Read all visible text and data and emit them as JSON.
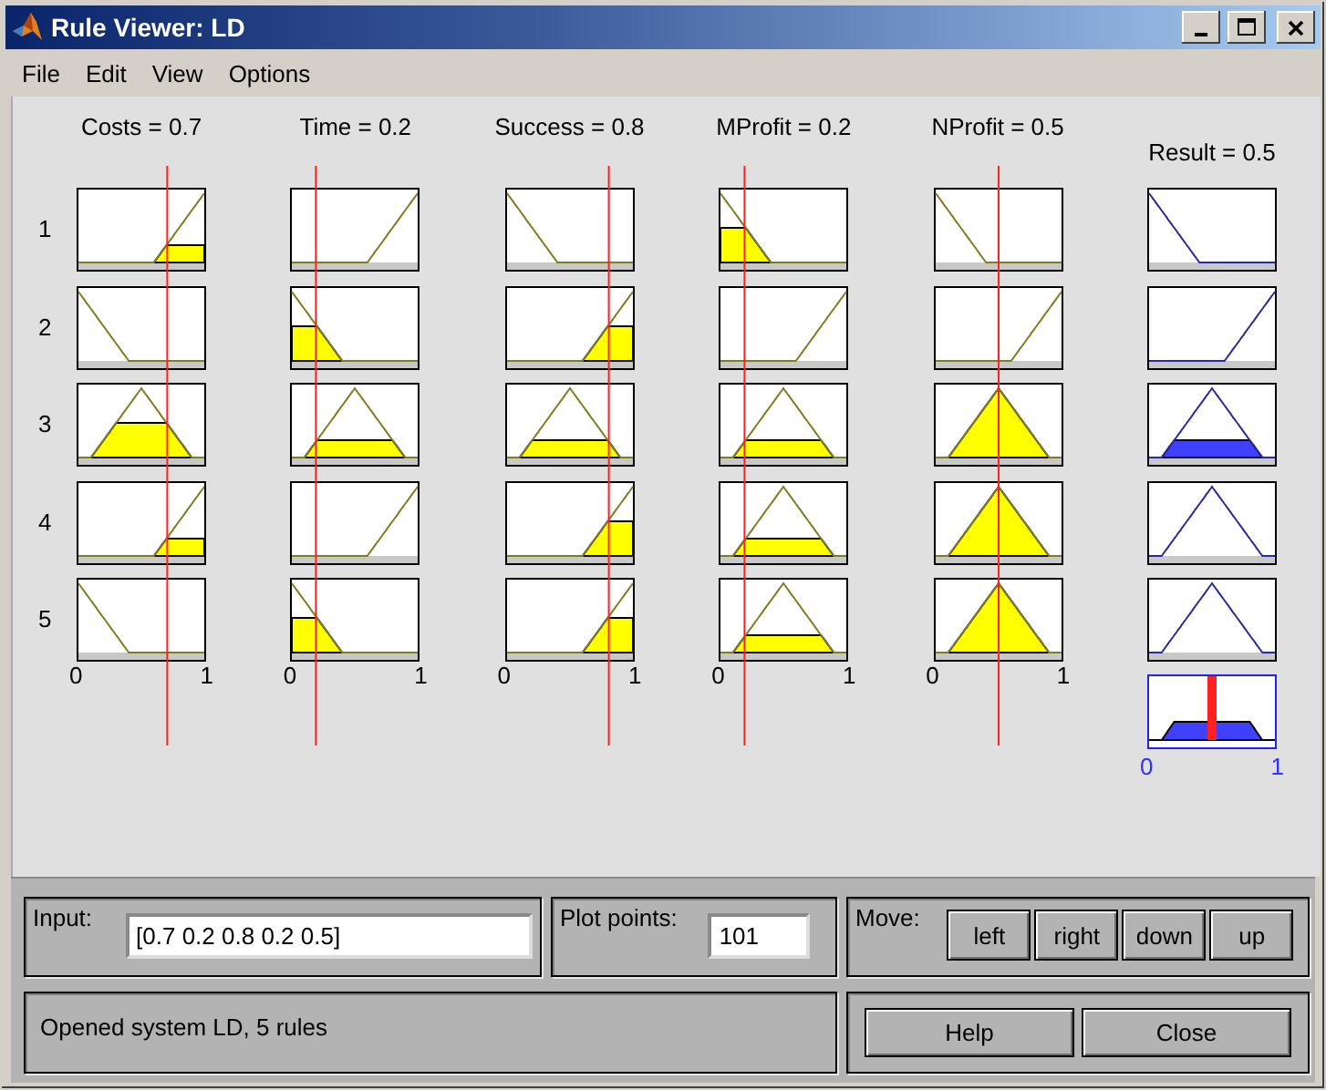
{
  "window": {
    "title": "Rule Viewer: LD"
  },
  "menu": [
    {
      "label": "File"
    },
    {
      "label": "Edit"
    },
    {
      "label": "View"
    },
    {
      "label": "Options"
    }
  ],
  "rule_numbers": [
    "1",
    "2",
    "3",
    "4",
    "5"
  ],
  "variables": [
    {
      "kind": "input",
      "label": "Costs = 0.7",
      "level": 0.7,
      "cells": [
        {
          "kind": "rising"
        },
        {
          "kind": "falling"
        },
        {
          "kind": "triangle"
        },
        {
          "kind": "rising"
        },
        {
          "kind": "falling"
        }
      ],
      "axis": [
        "0",
        "1"
      ]
    },
    {
      "kind": "input",
      "label": "Time = 0.2",
      "level": 0.2,
      "cells": [
        {
          "kind": "rising"
        },
        {
          "kind": "falling"
        },
        {
          "kind": "triangle"
        },
        {
          "kind": "rising"
        },
        {
          "kind": "falling"
        }
      ],
      "axis": [
        "0",
        "1"
      ]
    },
    {
      "kind": "input",
      "label": "Success = 0.8",
      "level": 0.8,
      "cells": [
        {
          "kind": "falling"
        },
        {
          "kind": "rising"
        },
        {
          "kind": "triangle"
        },
        {
          "kind": "rising"
        },
        {
          "kind": "rising"
        }
      ],
      "axis": [
        "0",
        "1"
      ]
    },
    {
      "kind": "input",
      "label": "MProfit = 0.2",
      "level": 0.2,
      "cells": [
        {
          "kind": "falling"
        },
        {
          "kind": "rising"
        },
        {
          "kind": "triangle"
        },
        {
          "kind": "triangle"
        },
        {
          "kind": "triangle"
        }
      ],
      "axis": [
        "0",
        "1"
      ]
    },
    {
      "kind": "input",
      "label": "NProfit = 0.5",
      "level": 0.5,
      "cells": [
        {
          "kind": "falling"
        },
        {
          "kind": "rising"
        },
        {
          "kind": "triangle"
        },
        {
          "kind": "triangle"
        },
        {
          "kind": "triangle"
        }
      ],
      "axis": [
        "0",
        "1"
      ]
    },
    {
      "kind": "output",
      "label": "Result = 0.5",
      "level": 0.5,
      "cells": [
        {
          "kind": "falling"
        },
        {
          "kind": "rising"
        },
        {
          "kind": "triangle"
        },
        {
          "kind": "triangle"
        },
        {
          "kind": "triangle"
        }
      ],
      "axis": [
        "0",
        "1"
      ]
    }
  ],
  "input": {
    "label": "Input:",
    "value": "[0.7 0.2 0.8 0.2 0.5]"
  },
  "plot_points": {
    "label": "Plot points:",
    "value": "101"
  },
  "move": {
    "label": "Move:",
    "buttons": [
      "left",
      "right",
      "down",
      "up"
    ]
  },
  "status": "Opened system LD, 5 rules",
  "buttons": [
    "Help",
    "Close"
  ]
}
